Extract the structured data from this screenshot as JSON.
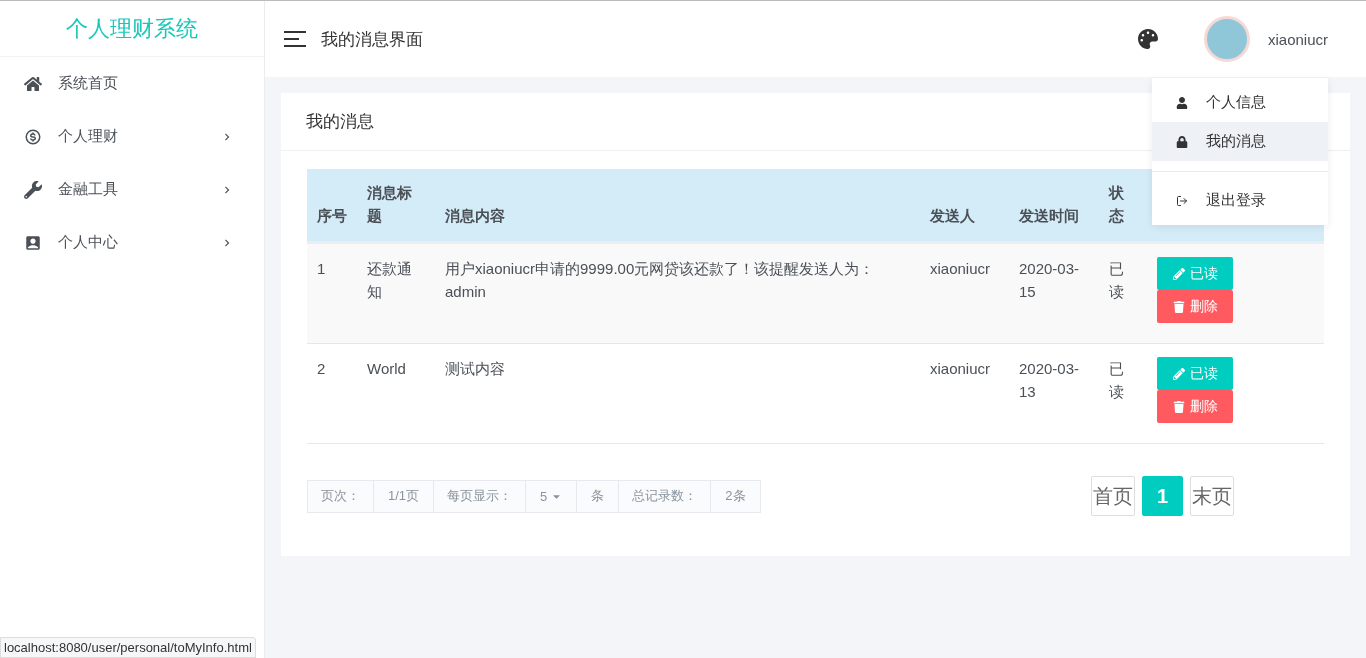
{
  "sidebar": {
    "logo": "个人理财系统",
    "items": [
      {
        "label": "系统首页",
        "has_submenu": false
      },
      {
        "label": "个人理财",
        "has_submenu": true
      },
      {
        "label": "金融工具",
        "has_submenu": true
      },
      {
        "label": "个人中心",
        "has_submenu": true
      }
    ]
  },
  "header": {
    "title": "我的消息界面",
    "username": "xiaoniucr"
  },
  "user_menu": {
    "groups": [
      [
        {
          "label": "个人信息",
          "selected": false
        },
        {
          "label": "我的消息",
          "selected": true
        }
      ],
      [
        {
          "label": "退出登录",
          "selected": false
        }
      ]
    ]
  },
  "card": {
    "title": "我的消息"
  },
  "table": {
    "columns": [
      "序号",
      "消息标题",
      "消息内容",
      "发送人",
      "发送时间",
      "状态"
    ],
    "rows": [
      {
        "cells": [
          "1",
          "还款通知",
          "用户xiaoniucr申请的9999.00元网贷该还款了！该提醒发送人为：admin",
          "xiaoniucr",
          "2020-03-15",
          "已读"
        ],
        "actions": [
          "已读",
          "删除"
        ]
      },
      {
        "cells": [
          "2",
          "World",
          "测试内容",
          "xiaoniucr",
          "2020-03-13",
          "已读"
        ],
        "actions": [
          "已读",
          "删除"
        ]
      }
    ]
  },
  "pager_info": [
    {
      "kind": "label",
      "text": "页次："
    },
    {
      "kind": "value",
      "text": "1/1页"
    },
    {
      "kind": "label",
      "text": "每页显示："
    },
    {
      "kind": "select",
      "text": "5"
    },
    {
      "kind": "value",
      "text": "条"
    },
    {
      "kind": "label",
      "text": "总记录数："
    },
    {
      "kind": "value",
      "text": "2条"
    }
  ],
  "pagination": [
    {
      "label": "首页",
      "selected": false
    },
    {
      "label": "1",
      "selected": true
    },
    {
      "label": "末页",
      "selected": false
    }
  ],
  "status_url": "localhost:8080/user/personal/toMyInfo.html"
}
